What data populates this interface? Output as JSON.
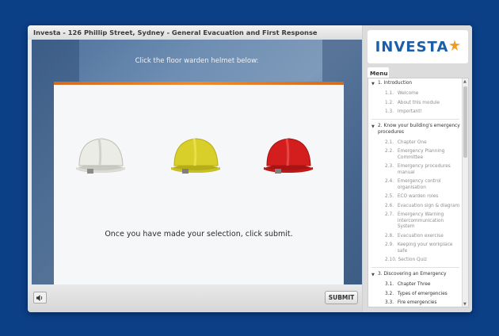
{
  "window": {
    "title": "Investa - 126 Phillip Street, Sydney - General Evacuation and First Response"
  },
  "stage": {
    "instruction": "Click the floor warden helmet below:",
    "helmets": [
      {
        "color_name": "white",
        "color": "#ecece6"
      },
      {
        "color_name": "yellow",
        "color": "#d8cf2a"
      },
      {
        "color_name": "red",
        "color": "#d41d1d"
      }
    ],
    "selection_text": "Once you have made your selection, click submit."
  },
  "controls": {
    "volume_icon": "speaker-icon",
    "submit_label": "SUBMIT"
  },
  "sidebar": {
    "logo": "INVESTA",
    "logo_colors": {
      "text": "#1d5ea8",
      "star": "#f29a1f"
    },
    "menu_tab": "Menu",
    "sections": [
      {
        "label": "1. Introduction",
        "items": [
          {
            "num": "1.1.",
            "label": "Welcome"
          },
          {
            "num": "1.2.",
            "label": "About this module"
          },
          {
            "num": "1.3.",
            "label": "Important!"
          }
        ]
      },
      {
        "label": "2. Know your building's emergency procedures",
        "items": [
          {
            "num": "2.1.",
            "label": "Chapter One"
          },
          {
            "num": "2.2.",
            "label": "Emergency Planning Committee"
          },
          {
            "num": "2.3.",
            "label": "Emergency procedures manual"
          },
          {
            "num": "2.4.",
            "label": "Emergency control organisation"
          },
          {
            "num": "2.5.",
            "label": "ECO warden roles"
          },
          {
            "num": "2.6.",
            "label": "Evacuation sign & diagram"
          },
          {
            "num": "2.7.",
            "label": "Emergency Warning Intercommunication System"
          },
          {
            "num": "2.8.",
            "label": "Evacuation exercise"
          },
          {
            "num": "2.9.",
            "label": "Keeping your workplace safe"
          },
          {
            "num": "2.10.",
            "label": "Section Quiz"
          }
        ]
      },
      {
        "label": "3. Discovering an Emergency",
        "items": [
          {
            "num": "3.1.",
            "label": "Chapter Three"
          },
          {
            "num": "3.2.",
            "label": "Types of emergencies"
          },
          {
            "num": "3.3.",
            "label": "Fire emergencies"
          }
        ]
      }
    ]
  }
}
